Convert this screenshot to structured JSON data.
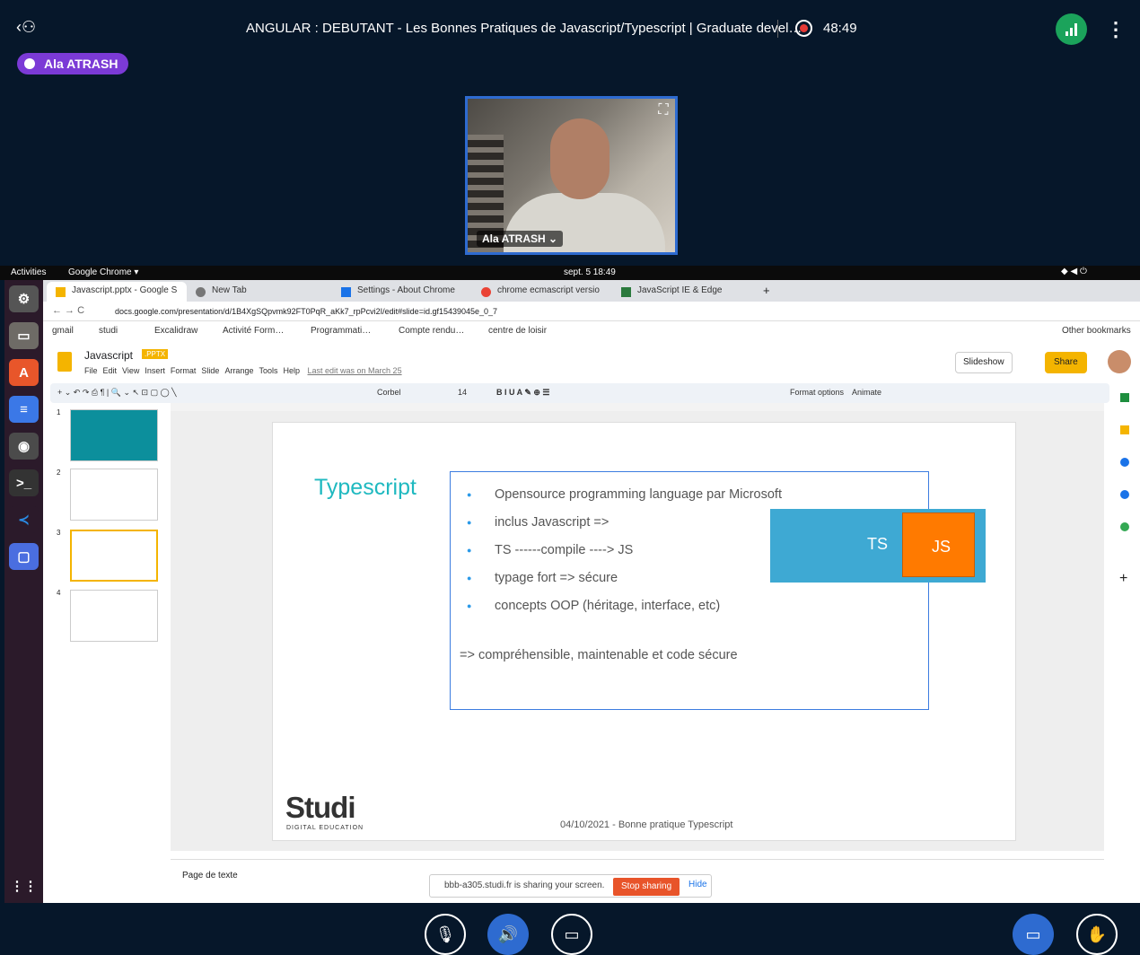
{
  "meeting": {
    "title": "ANGULAR : DEBUTANT - Les Bonnes Pratiques de Javascript/Typescript | Graduate devel…",
    "timer": "48:49",
    "presenter": "Ala ATRASH",
    "webcam_label": "Ala ATRASH ⌄"
  },
  "ubuntu": {
    "activities": "Activities",
    "app": "Google Chrome ▾",
    "clock": "sept. 5  18:49"
  },
  "tabs": [
    {
      "label": "Javascript.pptx - Google S"
    },
    {
      "label": "New Tab"
    },
    {
      "label": "Settings - About Chrome"
    },
    {
      "label": "chrome ecmascript versio"
    },
    {
      "label": "JavaScript IE & Edge"
    }
  ],
  "address": {
    "url": "docs.google.com/presentation/d/1B4XgSQpvmk92FT0PqR_aKk7_rpPcvi2I/edit#slide=id.gf15439045e_0_7"
  },
  "bookmarks": [
    "gmail",
    "studi",
    "Excalidraw",
    "Activité Form…",
    "Programmati…",
    "Compte rendu…",
    "centre de loisir",
    "Other bookmarks"
  ],
  "slides": {
    "doc_title": "Javascript",
    "badge": ".PPTX",
    "menus": [
      "File",
      "Edit",
      "View",
      "Insert",
      "Format",
      "Slide",
      "Arrange",
      "Tools",
      "Help"
    ],
    "last_edit": "Last edit was on March 25",
    "slideshow": "Slideshow",
    "share": "Share",
    "font": "Corbel",
    "font_size": "14",
    "format_options": "Format options",
    "animate": "Animate"
  },
  "slide": {
    "title": "Typescript",
    "bullets": [
      "Opensource programming language par Microsoft",
      "inclus Javascript =>",
      "TS ------compile ----> JS",
      "typage fort => sécure",
      "concepts OOP (héritage, interface, etc)"
    ],
    "conclusion": "=> compréhensible, maintenable et code sécure",
    "ts": "TS",
    "js": "JS",
    "logo": "Studi",
    "logo_sub": "DIGITAL EDUCATION",
    "footer": "04/10/2021 - Bonne pratique Typescript"
  },
  "thumbs": [
    "1",
    "2",
    "3",
    "4"
  ],
  "notes": {
    "label": "Page de texte"
  },
  "share_notice": {
    "text": "bbb-a305.studi.fr is sharing your screen.",
    "stop": "Stop sharing",
    "hide": "Hide"
  }
}
